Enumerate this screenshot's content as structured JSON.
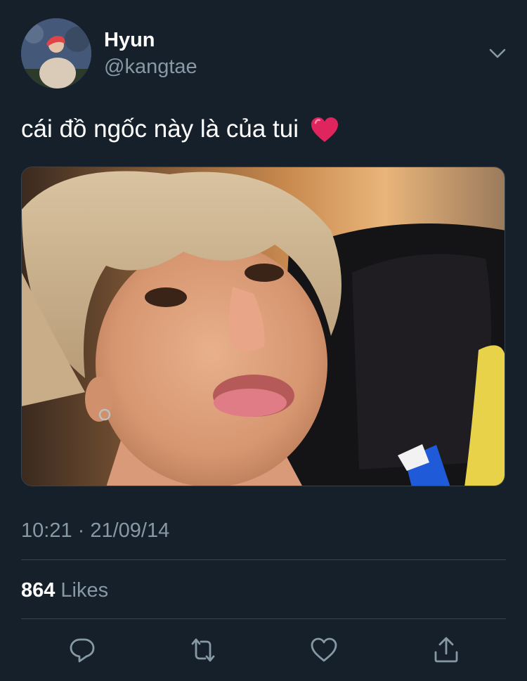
{
  "tweet": {
    "author": {
      "name": "Hyun",
      "handle": "@kangtae"
    },
    "text": "cái đồ ngốc này là của tui",
    "emoji": "heart-emoji",
    "timestamp": "10:21 · 21/09/14",
    "likes": {
      "count": "864",
      "label": "Likes"
    }
  },
  "icons": {
    "more": "chevron-down-icon",
    "reply": "reply-icon",
    "retweet": "retweet-icon",
    "like": "heart-icon",
    "share": "share-icon"
  },
  "colors": {
    "background": "#15202b",
    "secondary_text": "#8899a6",
    "divider": "#38444d",
    "heart": "#e0245e"
  }
}
